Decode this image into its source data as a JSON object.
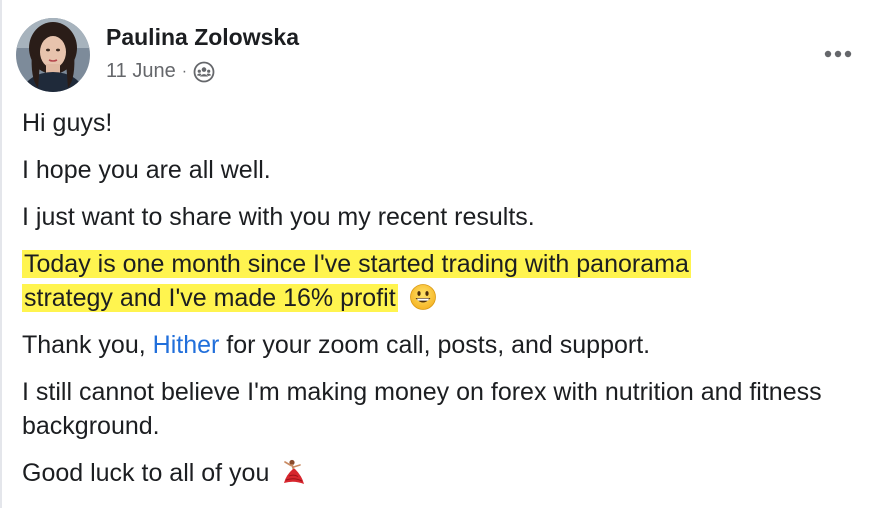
{
  "post": {
    "author_name": "Paulina Zolowska",
    "date": "11 June",
    "separator": "·",
    "audience_icon": "group-audience-icon",
    "more_icon": "more-options-icon",
    "paragraphs": {
      "p1": "Hi guys!",
      "p2": "I hope you are all well.",
      "p3": "I just want to share with you my recent results.",
      "p4_line1": "Today is one month since I've started trading with panorama",
      "p4_line2": "strategy and I've made 16% profit",
      "p5_before": "Thank you, ",
      "p5_mention": "Hither",
      "p5_after": " for your zoom call, posts, and support.",
      "p6": "I still cannot believe I'm making money on forex with nutrition and fitness background.",
      "p7": "Good luck to all of you"
    },
    "emojis": {
      "grin": "grinning-face-emoji",
      "dancer": "dancer-emoji"
    },
    "colors": {
      "highlight": "#fff44f",
      "mention": "#216fdb",
      "meta_text": "#65676b"
    }
  }
}
